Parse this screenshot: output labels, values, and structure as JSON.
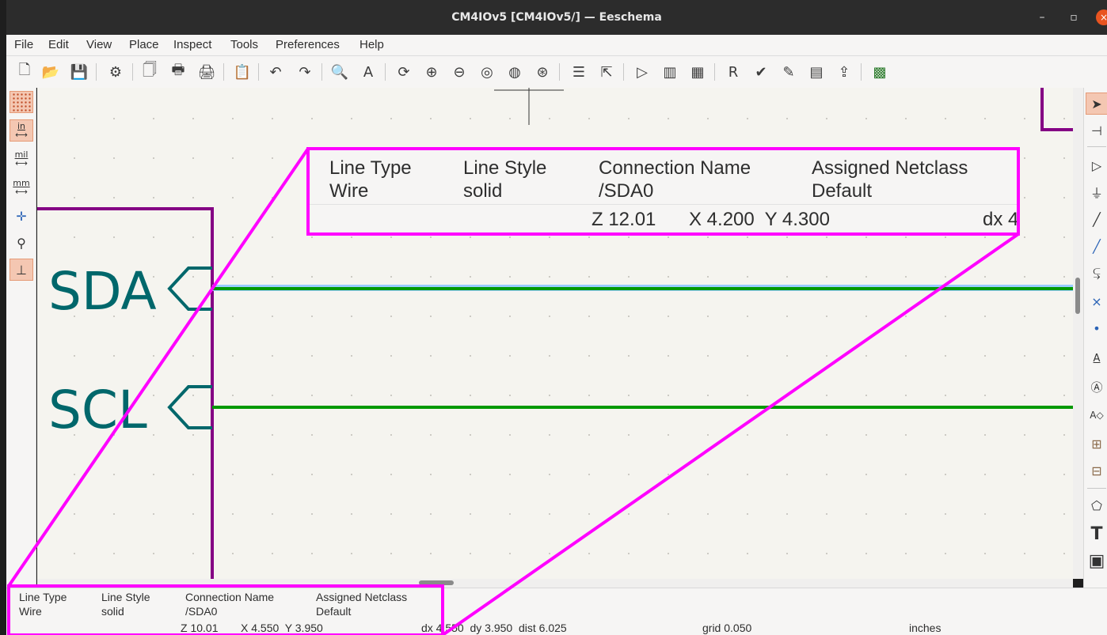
{
  "window": {
    "title": "CM4IOv5 [CM4IOv5/] — Eeschema",
    "minimize_glyph": "–",
    "maximize_glyph": "▫",
    "close_glyph": "×"
  },
  "menu": [
    "File",
    "Edit",
    "View",
    "Place",
    "Inspect",
    "Tools",
    "Preferences",
    "Help"
  ],
  "toolbar": {
    "icons": [
      {
        "name": "new-icon",
        "glyph": "🗋"
      },
      {
        "name": "open-icon",
        "glyph": "📂"
      },
      {
        "name": "save-icon",
        "glyph": "💾"
      },
      {
        "name": "schematic-setup-icon",
        "glyph": "⚙"
      },
      {
        "name": "page-settings-icon",
        "glyph": "🗍"
      },
      {
        "name": "print-icon",
        "glyph": "🖶"
      },
      {
        "name": "plot-icon",
        "glyph": "🖨"
      },
      {
        "name": "paste-icon",
        "glyph": "📋"
      },
      {
        "name": "undo-icon",
        "glyph": "↶"
      },
      {
        "name": "redo-icon",
        "glyph": "↷"
      },
      {
        "name": "find-icon",
        "glyph": "🔍"
      },
      {
        "name": "find-replace-icon",
        "glyph": "A"
      },
      {
        "name": "refresh-icon",
        "glyph": "⟳"
      },
      {
        "name": "zoom-in-icon",
        "glyph": "⊕"
      },
      {
        "name": "zoom-out-icon",
        "glyph": "⊖"
      },
      {
        "name": "zoom-fit-icon",
        "glyph": "◎"
      },
      {
        "name": "zoom-objects-icon",
        "glyph": "◍"
      },
      {
        "name": "zoom-selection-icon",
        "glyph": "⊛"
      },
      {
        "name": "hierarchy-navigator-icon",
        "glyph": "☰"
      },
      {
        "name": "leave-sheet-icon",
        "glyph": "⇱"
      },
      {
        "name": "symbol-editor-icon",
        "glyph": "▷"
      },
      {
        "name": "symbol-browser-icon",
        "glyph": "▥"
      },
      {
        "name": "footprint-editor-icon",
        "glyph": "▦"
      },
      {
        "name": "annotate-icon",
        "glyph": "R"
      },
      {
        "name": "erc-icon",
        "glyph": "✔"
      },
      {
        "name": "symbol-fields-icon",
        "glyph": "✎"
      },
      {
        "name": "edit-fields-table-icon",
        "glyph": "▤"
      },
      {
        "name": "bom-icon",
        "glyph": "⇪"
      },
      {
        "name": "pcb-editor-icon",
        "glyph": "▩"
      }
    ]
  },
  "left_toolbar": {
    "unit_in": "in",
    "unit_mil": "mil",
    "unit_mm": "mm",
    "arrow_glyph": "⟷",
    "cursor_glyph": "✛",
    "hidden_pins_glyph": "⚲",
    "wire_mode_glyph": "⊥"
  },
  "right_toolbar": {
    "select_glyph": "➤",
    "highlight_glyph": "⊣",
    "symbol_glyph": "▷",
    "power_glyph": "⏚",
    "wire_glyph": "╱",
    "bus_glyph": "╱",
    "bus_entry_glyph": "⥹",
    "no_connect_glyph": "×",
    "junction_glyph": "•",
    "label_glyph": "A",
    "global_label_glyph": "Ⓐ",
    "hier_label_glyph": "A◇",
    "sheet_glyph": "⊞",
    "sheet_pin_glyph": "⊟",
    "graphic_line_glyph": "⬠",
    "text_glyph": "T",
    "image_glyph": "▣"
  },
  "schematic": {
    "labels": [
      "SDA",
      "SCL"
    ],
    "colors": {
      "wire": "#009900",
      "label": "#00676b",
      "sheet_border": "#840084",
      "highlight": "#ff00ff",
      "selected_wire": "#99ccff"
    }
  },
  "message_panel": {
    "items": [
      {
        "title": "Line Type",
        "value": "Wire"
      },
      {
        "title": "Line Style",
        "value": "solid"
      },
      {
        "title": "Connection Name",
        "value": "/SDA0"
      },
      {
        "title": "Assigned Netclass",
        "value": "Default"
      }
    ],
    "status": {
      "zoom": "Z 10.01",
      "coords": "X 4.550  Y 3.950",
      "delta": "dx 4.550  dy 3.950  dist 6.025",
      "grid": "grid 0.050",
      "units": "inches"
    }
  },
  "zoom_callout": {
    "items": [
      {
        "title": "Line Type",
        "value": "Wire"
      },
      {
        "title": "Line Style",
        "value": "solid"
      },
      {
        "title": "Connection Name",
        "value": "/SDA0"
      },
      {
        "title": "Assigned Netclass",
        "value": "Default"
      }
    ],
    "status": {
      "zoom": "Z 12.01",
      "coords": "X 4.200  Y 4.300",
      "delta": "dx 4"
    }
  }
}
